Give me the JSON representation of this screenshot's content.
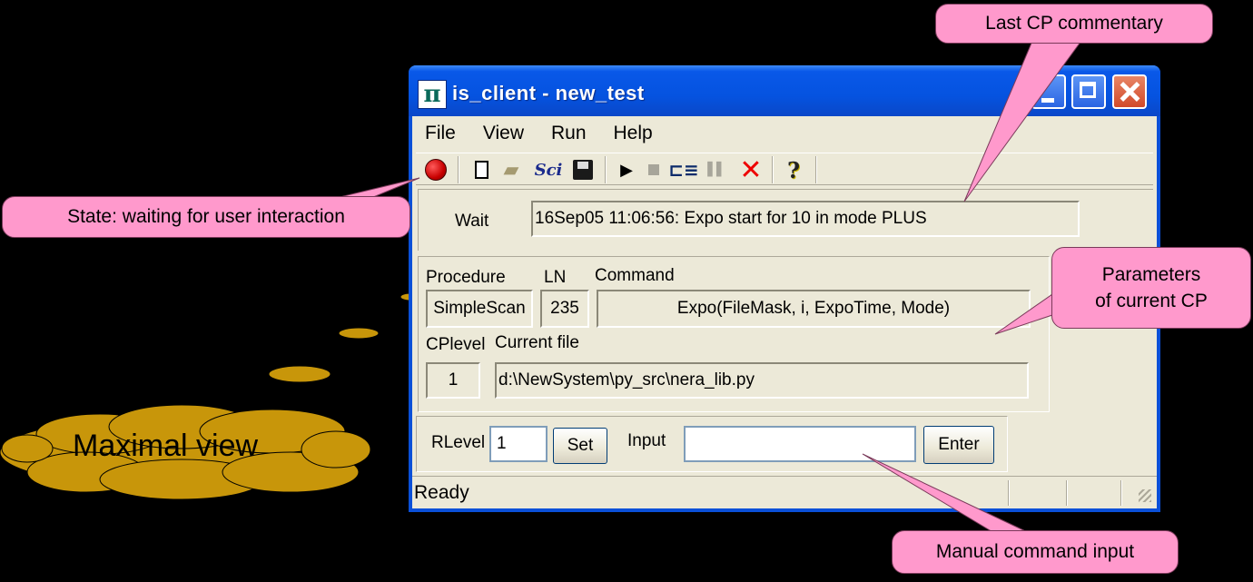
{
  "window": {
    "title": "is_client - new_test",
    "app_icon": "pi-icon"
  },
  "menubar": [
    "File",
    "View",
    "Run",
    "Help"
  ],
  "toolbar": {
    "icons": [
      "record-state-icon",
      "new-file-icon",
      "open-folder-icon",
      "sci-icon",
      "save-icon",
      "play-icon",
      "stop-icon",
      "step-icon",
      "pause-icon",
      "abort-icon",
      "help-icon"
    ],
    "sci_label": "Sci"
  },
  "state": {
    "label": "Wait",
    "commentary": "16Sep05 11:06:56:  Expo start for 10 in mode PLUS"
  },
  "current_cp": {
    "procedure_label": "Procedure",
    "procedure": "SimpleScan",
    "ln_label": "LN",
    "ln": "235",
    "command_label": "Command",
    "command": "Expo(FileMask, i, ExpoTime, Mode)",
    "cplevel_label": "CPlevel",
    "cplevel": "1",
    "current_file_label": "Current file",
    "current_file": "d:\\NewSystem\\py_src\\nera_lib.py"
  },
  "controls": {
    "rlevel_label": "RLevel",
    "rlevel_value": "1",
    "set_label": "Set",
    "input_label": "Input",
    "input_value": "",
    "enter_label": "Enter"
  },
  "statusbar": {
    "text": "Ready"
  },
  "annotations": {
    "last_cp": "Last CP commentary",
    "state": "State: waiting for user interaction",
    "parameters_line1": "Parameters",
    "parameters_line2": "of current CP",
    "manual_input": "Manual command input",
    "maximal_view": "Maximal view"
  },
  "colors": {
    "callout": "#ff99cc",
    "cloud": "#c8960a",
    "titlebar": "#0553e0",
    "window_bg": "#ece9d8"
  }
}
